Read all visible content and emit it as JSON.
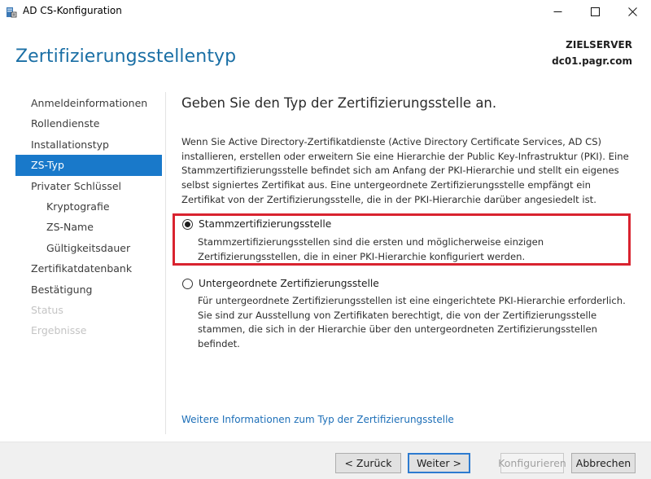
{
  "window": {
    "title": "AD CS-Konfiguration"
  },
  "header": {
    "page_title": "Zertifizierungsstellentyp",
    "server_label": "ZIELSERVER",
    "server_name": "dc01.pagr.com"
  },
  "sidebar": {
    "items": [
      {
        "label": "Anmeldeinformationen",
        "state": "normal"
      },
      {
        "label": "Rollendienste",
        "state": "normal"
      },
      {
        "label": "Installationstyp",
        "state": "normal"
      },
      {
        "label": "ZS-Typ",
        "state": "active"
      },
      {
        "label": "Privater Schlüssel",
        "state": "normal"
      },
      {
        "label": "Kryptografie",
        "state": "normal",
        "sub": true
      },
      {
        "label": "ZS-Name",
        "state": "normal",
        "sub": true
      },
      {
        "label": "Gültigkeitsdauer",
        "state": "normal",
        "sub": true
      },
      {
        "label": "Zertifikatdatenbank",
        "state": "normal"
      },
      {
        "label": "Bestätigung",
        "state": "normal"
      },
      {
        "label": "Status",
        "state": "disabled"
      },
      {
        "label": "Ergebnisse",
        "state": "disabled"
      }
    ]
  },
  "main": {
    "heading": "Geben Sie den Typ der Zertifizierungsstelle an.",
    "intro": "Wenn Sie Active Directory-Zertifikatdienste (Active Directory Certificate Services, AD CS) installieren, erstellen oder erweitern Sie eine Hierarchie der Public Key-Infrastruktur (PKI). Eine Stammzertifizierungsstelle befindet sich am Anfang der PKI-Hierarchie und stellt ein eigenes selbst signiertes Zertifikat aus. Eine untergeordnete Zertifizierungsstelle empfängt ein Zertifikat von der Zertifizierungsstelle, die in der PKI-Hierarchie darüber angesiedelt ist.",
    "options": [
      {
        "label": "Stammzertifizierungsstelle",
        "selected": true,
        "description": "Stammzertifizierungsstellen sind die ersten und möglicherweise einzigen Zertifizierungsstellen, die in einer PKI-Hierarchie konfiguriert werden."
      },
      {
        "label": "Untergeordnete Zertifizierungsstelle",
        "selected": false,
        "description": "Für untergeordnete Zertifizierungsstellen ist eine eingerichtete PKI-Hierarchie erforderlich. Sie sind zur Ausstellung von Zertifikaten berechtigt, die von der Zertifizierungsstelle stammen, die sich in der Hierarchie über den untergeordneten Zertifizierungsstellen befindet."
      }
    ],
    "more_info_link": "Weitere Informationen zum Typ der Zertifizierungsstelle"
  },
  "footer": {
    "back_label": "< Zurück",
    "next_label": "Weiter >",
    "configure_label": "Konfigurieren",
    "cancel_label": "Abbrechen"
  },
  "colors": {
    "accent": "#1979ca",
    "title": "#1a6fa5",
    "highlight": "#d9232f",
    "link": "#1d6fb8"
  }
}
